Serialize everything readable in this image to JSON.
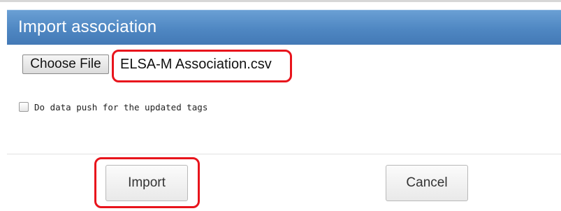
{
  "dialog": {
    "title": "Import association"
  },
  "file_input": {
    "button_label": "Choose File",
    "file_name": "ELSA-M Association.csv"
  },
  "options": {
    "data_push_label": "Do data push for the updated tags",
    "data_push_checked": false
  },
  "actions": {
    "import_label": "Import",
    "cancel_label": "Cancel"
  },
  "annotations": {
    "highlight_color": "#e8141c"
  },
  "colors": {
    "titlebar": "#4f87c2",
    "title_text": "#ffffff"
  }
}
